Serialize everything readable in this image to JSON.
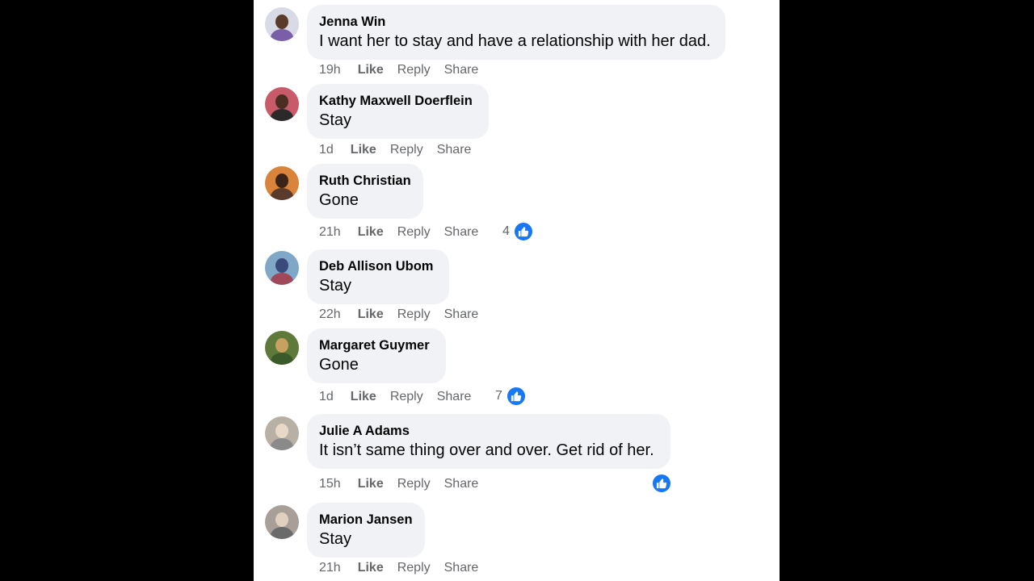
{
  "colors": {
    "background": "#000000",
    "panel": "#ffffff",
    "bubble": "#f0f2f5",
    "name": "#050505",
    "meta": "#65676b",
    "like_accent": "#1877f2"
  },
  "actions": {
    "like": "Like",
    "reply": "Reply",
    "share": "Share"
  },
  "comments": [
    {
      "author": "Jenna Win",
      "text": "I want her to stay and have a relationship with her dad.",
      "time": "19h",
      "reactions": null
    },
    {
      "author": "Kathy Maxwell Doerflein",
      "text": "Stay",
      "time": "1d",
      "reactions": null
    },
    {
      "author": "Ruth Christian",
      "text": "Gone",
      "time": "21h",
      "reactions": "4",
      "reaction_icon": "thumbs-up-icon"
    },
    {
      "author": "Deb Allison Ubom",
      "text": "Stay",
      "time": "22h",
      "reactions": null
    },
    {
      "author": "Margaret Guymer",
      "text": "Gone",
      "time": "1d",
      "reactions": "7",
      "reaction_icon": "thumbs-up-icon"
    },
    {
      "author": "Julie A Adams",
      "text": "It isn’t same thing over and over. Get rid of her.",
      "time": "15h",
      "reactions": "",
      "reaction_icon": "thumbs-up-icon"
    },
    {
      "author": "Marion Jansen",
      "text": "Stay",
      "time": "21h",
      "reactions": null
    }
  ]
}
